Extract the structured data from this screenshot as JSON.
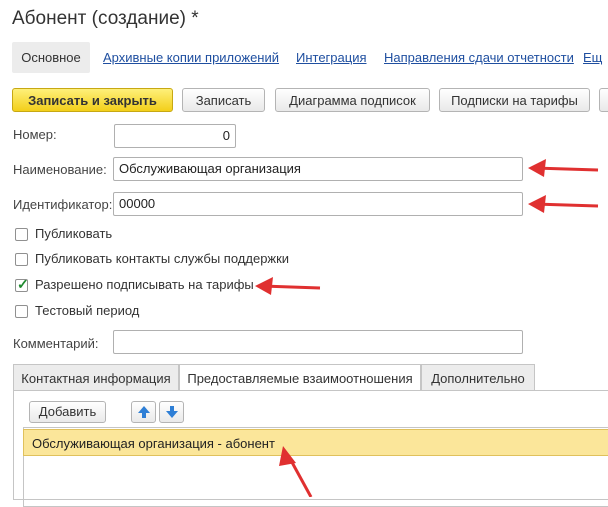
{
  "window": {
    "title": "Абонент (создание) *"
  },
  "nav": {
    "active": "Основное",
    "links": [
      "Архивные копии приложений",
      "Интеграция",
      "Направления сдачи отчетности",
      "Ещ"
    ]
  },
  "toolbar": {
    "save_close": "Записать и закрыть",
    "save": "Записать",
    "diagram": "Диаграмма подписок",
    "tariffs": "Подписки на тарифы"
  },
  "form": {
    "number_label": "Номер:",
    "number_value": "0",
    "name_label": "Наименование:",
    "name_value": "Обслуживающая организация",
    "id_label": "Идентификатор:",
    "id_value": "00000",
    "publish_label": "Публиковать",
    "publish_support_label": "Публиковать контакты службы поддержки",
    "allow_tariffs_label": "Разрешено подписывать на тарифы",
    "test_period_label": "Тестовый период",
    "comment_label": "Комментарий:",
    "comment_value": ""
  },
  "checkboxes": {
    "publish": false,
    "publish_support": false,
    "allow_tariffs": true,
    "test_period": false
  },
  "tabs": [
    "Контактная информация",
    "Предоставляемые взаимоотношения",
    "Дополнительно"
  ],
  "panel": {
    "add_label": "Добавить",
    "rows": [
      "Обслуживающая организация - абонент"
    ]
  },
  "colors": {
    "accent_yellow": "#f6d529",
    "link": "#1f4fa0",
    "arrow": "#e03030",
    "selected_row": "#fbe69a"
  }
}
